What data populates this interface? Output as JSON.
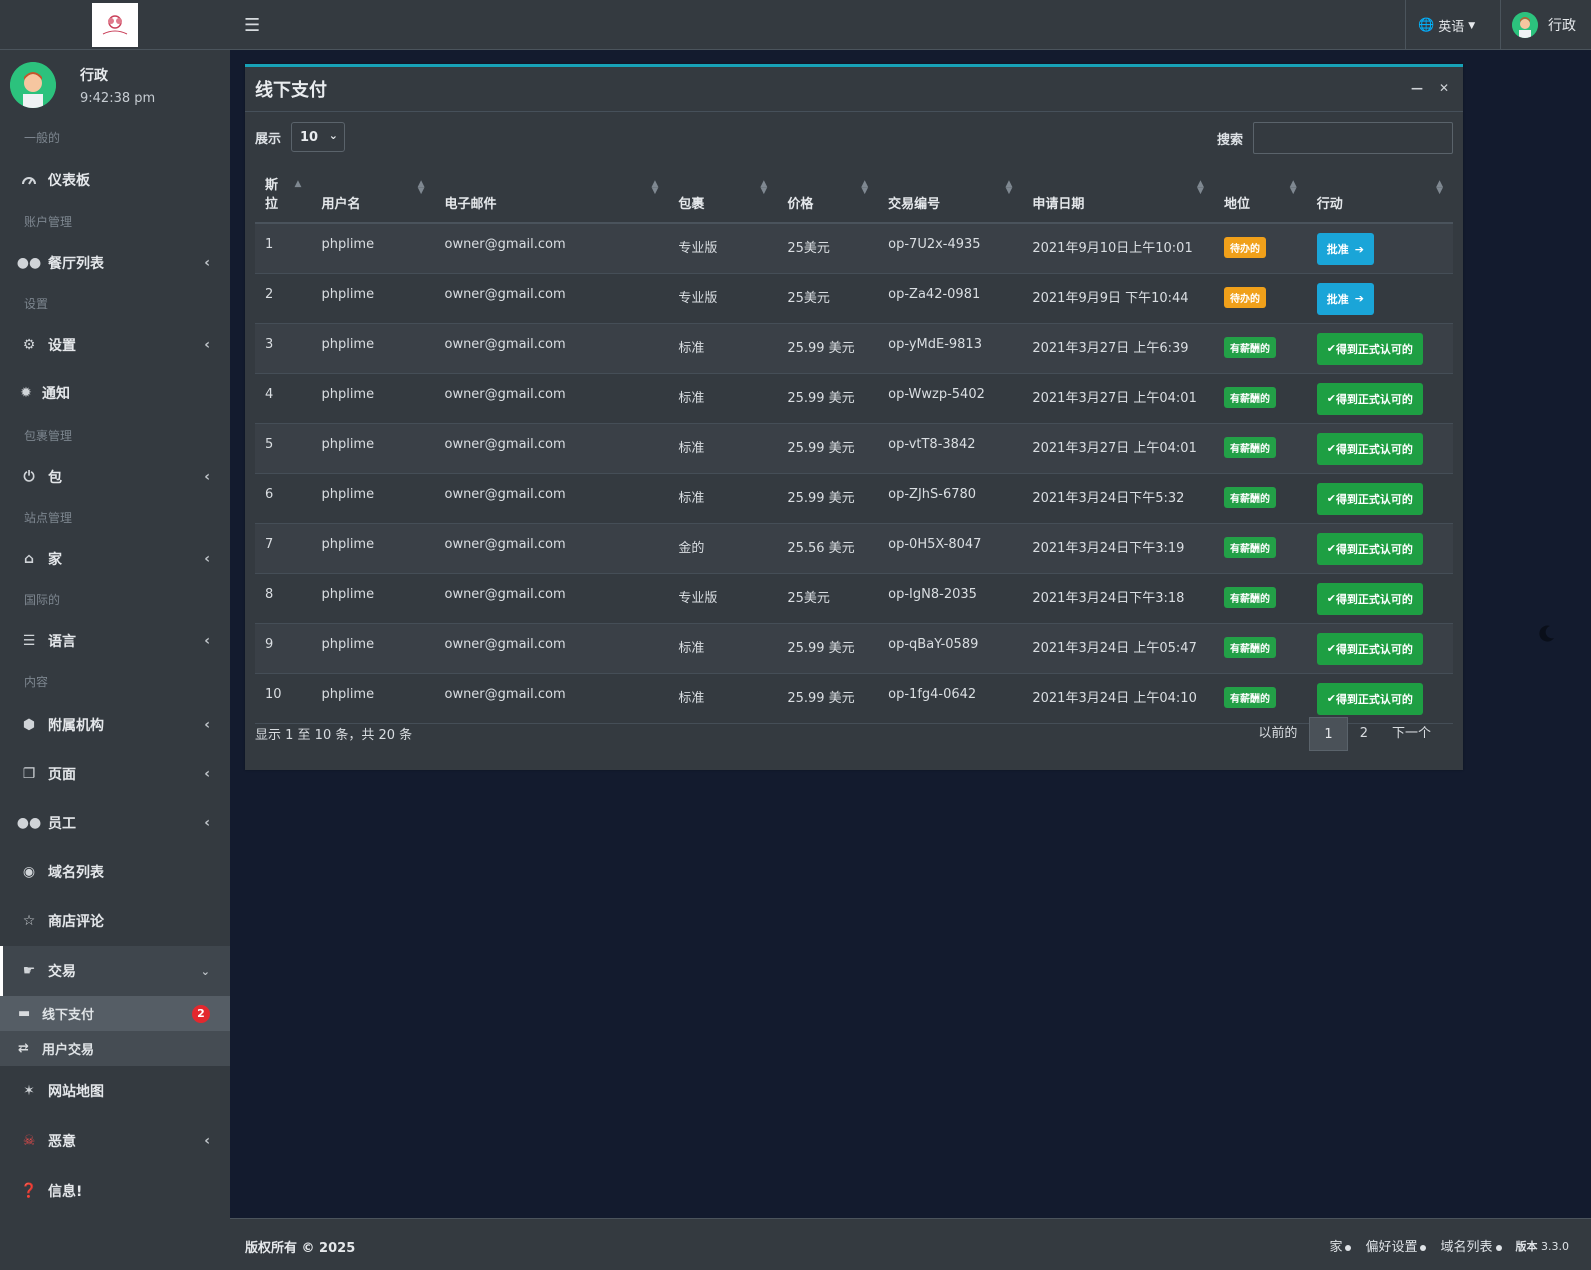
{
  "sidebar": {
    "user": {
      "name": "行政",
      "time": "9:42:38 pm"
    },
    "headers": {
      "general": "一般的",
      "account": "账户管理",
      "settings": "设置",
      "packages": "包裹管理",
      "sites": "站点管理",
      "intl": "国际的",
      "content": "内容"
    },
    "items": {
      "dashboard": "仪表板",
      "restaurants": "餐厅列表",
      "settings": "设置",
      "notify": "通知",
      "package": "包",
      "home": "家",
      "language": "语言",
      "affiliates": "附属机构",
      "pages": "页面",
      "staff": "员工",
      "domains": "域名列表",
      "reviews": "商店评论",
      "transactions": "交易",
      "offline_pay": "线下支付",
      "offline_badge": "2",
      "user_tx": "用户交易",
      "sitemap": "网站地图",
      "malicious": "恶意",
      "info": "信息!"
    }
  },
  "topbar": {
    "lang": "英语",
    "user": "行政"
  },
  "card": {
    "title": "线下支付",
    "show_label": "展示",
    "show_value": "10",
    "search_label": "搜索",
    "columns": [
      "斯\n拉",
      "用户名",
      "电子邮件",
      "包裹",
      "价格",
      "交易编号",
      "申请日期",
      "地位",
      "行动"
    ],
    "rows": [
      {
        "sl": "1",
        "user": "phplime",
        "email": "owner@gmail.com",
        "pkg": "专业版",
        "price": "25美元",
        "tx": "op-7U2x-4935",
        "date": "2021年9月10日上午10:01",
        "status": "待办的",
        "action": "批准"
      },
      {
        "sl": "2",
        "user": "phplime",
        "email": "owner@gmail.com",
        "pkg": "专业版",
        "price": "25美元",
        "tx": "op-Za42-0981",
        "date": "2021年9月9日 下午10:44",
        "status": "待办的",
        "action": "批准"
      },
      {
        "sl": "3",
        "user": "phplime",
        "email": "owner@gmail.com",
        "pkg": "标准",
        "price": "25.99 美元",
        "tx": "op-yMdE-9813",
        "date": "2021年3月27日 上午6:39",
        "status": "有薪酬的",
        "action": "得到正式认可的"
      },
      {
        "sl": "4",
        "user": "phplime",
        "email": "owner@gmail.com",
        "pkg": "标准",
        "price": "25.99 美元",
        "tx": "op-Wwzp-5402",
        "date": "2021年3月27日 上午04:01",
        "status": "有薪酬的",
        "action": "得到正式认可的"
      },
      {
        "sl": "5",
        "user": "phplime",
        "email": "owner@gmail.com",
        "pkg": "标准",
        "price": "25.99 美元",
        "tx": "op-vtT8-3842",
        "date": "2021年3月27日 上午04:01",
        "status": "有薪酬的",
        "action": "得到正式认可的"
      },
      {
        "sl": "6",
        "user": "phplime",
        "email": "owner@gmail.com",
        "pkg": "标准",
        "price": "25.99 美元",
        "tx": "op-ZJhS-6780",
        "date": "2021年3月24日下午5:32",
        "status": "有薪酬的",
        "action": "得到正式认可的"
      },
      {
        "sl": "7",
        "user": "phplime",
        "email": "owner@gmail.com",
        "pkg": "金的",
        "price": "25.56 美元",
        "tx": "op-0H5X-8047",
        "date": "2021年3月24日下午3:19",
        "status": "有薪酬的",
        "action": "得到正式认可的"
      },
      {
        "sl": "8",
        "user": "phplime",
        "email": "owner@gmail.com",
        "pkg": "专业版",
        "price": "25美元",
        "tx": "op-IgN8-2035",
        "date": "2021年3月24日下午3:18",
        "status": "有薪酬的",
        "action": "得到正式认可的"
      },
      {
        "sl": "9",
        "user": "phplime",
        "email": "owner@gmail.com",
        "pkg": "标准",
        "price": "25.99 美元",
        "tx": "op-qBaY-0589",
        "date": "2021年3月24日 上午05:47",
        "status": "有薪酬的",
        "action": "得到正式认可的"
      },
      {
        "sl": "10",
        "user": "phplime",
        "email": "owner@gmail.com",
        "pkg": "标准",
        "price": "25.99 美元",
        "tx": "op-1fg4-0642",
        "date": "2021年3月24日 上午04:10",
        "status": "有薪酬的",
        "action": "得到正式认可的"
      }
    ],
    "info": "显示 1 至 10 条，共 20 条",
    "pager": {
      "prev": "以前的",
      "p1": "1",
      "p2": "2",
      "next": "下一个"
    }
  },
  "footer": {
    "copyright": "版权所有 © 2025",
    "links": [
      "家",
      "偏好设置",
      "域名列表"
    ],
    "version_label": "版本",
    "version": "3.3.0"
  },
  "colors": {
    "accent": "#17a2b8",
    "pending": "#f0a01a",
    "paid": "#23a047",
    "approve": "#1aa5d8",
    "approved": "#1e9f43"
  }
}
